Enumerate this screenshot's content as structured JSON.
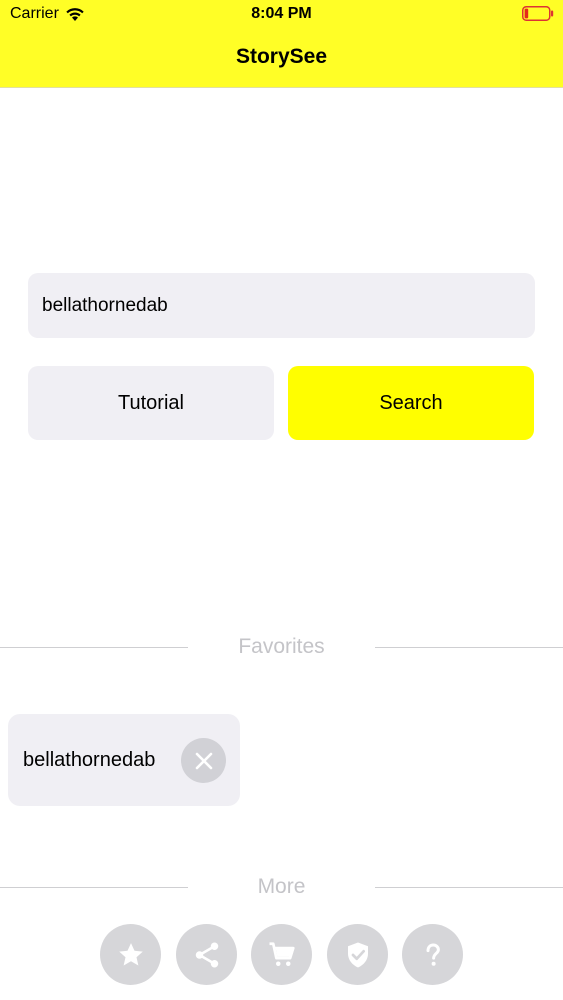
{
  "status_bar": {
    "carrier": "Carrier",
    "time": "8:04 PM"
  },
  "header": {
    "title": "StorySee",
    "background": "#fffe26"
  },
  "search": {
    "value": "bellathornedab",
    "placeholder": ""
  },
  "buttons": {
    "tutorial_label": "Tutorial",
    "search_label": "Search",
    "accent": "#fffe00"
  },
  "favorites": {
    "heading": "Favorites",
    "items": [
      {
        "name": "bellathornedab"
      }
    ]
  },
  "more": {
    "heading": "More",
    "actions": [
      {
        "icon": "star-icon"
      },
      {
        "icon": "share-icon"
      },
      {
        "icon": "cart-icon"
      },
      {
        "icon": "shield-check-icon"
      },
      {
        "icon": "question-icon"
      }
    ]
  }
}
